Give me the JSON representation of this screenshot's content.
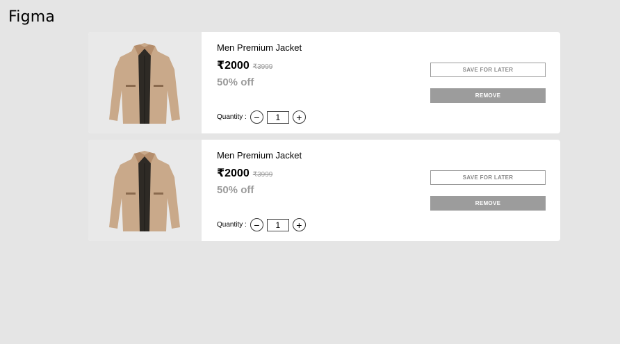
{
  "app": {
    "title": "Figma"
  },
  "cart": {
    "items": [
      {
        "name": "Men Premium Jacket",
        "price": "₹2000",
        "mrp": "₹3999",
        "discount": "50% off",
        "quantity_label": "Quantity :",
        "quantity": "1",
        "minus": "−",
        "plus": "+",
        "save_label": "SAVE FOR LATER",
        "remove_label": "REMOVE"
      },
      {
        "name": "Men Premium Jacket",
        "price": "₹2000",
        "mrp": "₹3999",
        "discount": "50% off",
        "quantity_label": "Quantity :",
        "quantity": "1",
        "minus": "−",
        "plus": "+",
        "save_label": "SAVE FOR LATER",
        "remove_label": "REMOVE"
      }
    ]
  },
  "colors": {
    "background": "#e5e5e5",
    "card": "#ffffff",
    "remove_button": "#9c9c9c",
    "muted_text": "#9b9b9b"
  }
}
